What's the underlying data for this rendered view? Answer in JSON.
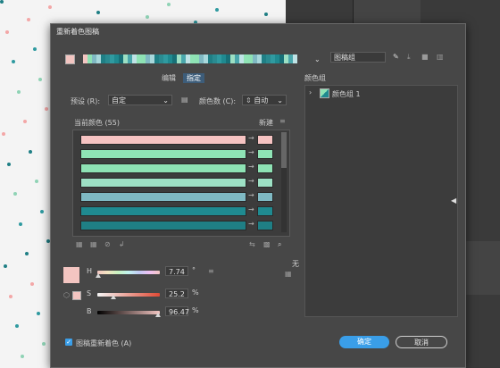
{
  "dialog": {
    "title": "重新着色图稿",
    "group_name": "图稿组",
    "tabs": [
      "编辑",
      "指定"
    ],
    "preset_label": "预设 (R):",
    "preset_value": "自定",
    "colors_label": "颜色数 (C):",
    "colors_value": "自动",
    "current_colors_label": "当前颜色 (55)",
    "new_label": "新建",
    "color_groups_label": "颜色组",
    "color_group_item": "颜色组 1",
    "none_label": "无",
    "h_label": "H",
    "h_value": "7.74",
    "h_unit": "°",
    "s_label": "S",
    "s_value": "25.2",
    "s_unit": "%",
    "b_label": "B",
    "b_value": "96.47",
    "b_unit": "%",
    "recolor_checkbox_label": "图稿重新着色 (A)",
    "ok_label": "确定",
    "cancel_label": "取消",
    "accent_color": "#3a9ee8",
    "selected_color": "#f3c5c1"
  },
  "rows": [
    {
      "current": "#f6c3c2",
      "new": "#f6c3c2"
    },
    {
      "current": "#8fe3b5",
      "new": "#8fe3b5"
    },
    {
      "current": "#8ee2b4",
      "new": "#8ee2b4"
    },
    {
      "current": "#9de0c4",
      "new": "#9de0c4"
    },
    {
      "current": "#7fb9c3",
      "new": "#7fb9c3"
    },
    {
      "current": "#1f8a90",
      "new": "#1f8a90"
    },
    {
      "current": "#1f7f85",
      "new": "#1f7f85"
    }
  ],
  "sliders": {
    "h_fraction": 0.021,
    "s_fraction": 0.252,
    "b_fraction": 0.965
  }
}
